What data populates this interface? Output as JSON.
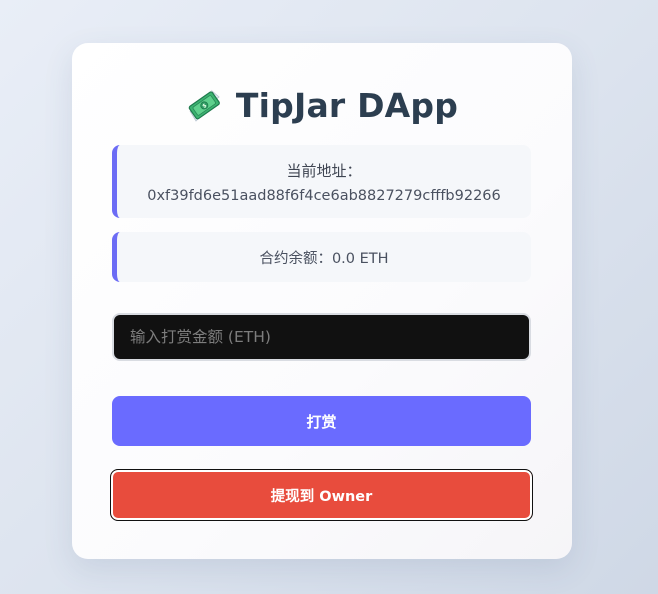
{
  "app": {
    "title": "TipJar DApp",
    "icon": "flying-money-icon"
  },
  "account": {
    "label": "当前地址：",
    "address": "0xf39fd6e51aad88f6f4ce6ab8827279cfffb92266"
  },
  "contract": {
    "balance_text": "合约余额：0.0 ETH"
  },
  "tip_input": {
    "value": "",
    "placeholder": "输入打赏金额 (ETH)"
  },
  "buttons": {
    "tip_label": "打赏",
    "withdraw_label": "提现到 Owner"
  },
  "colors": {
    "accent": "#6a6bff",
    "danger": "#e84c3d",
    "title": "#2c3e50",
    "info_border": "#6c6cf5"
  }
}
